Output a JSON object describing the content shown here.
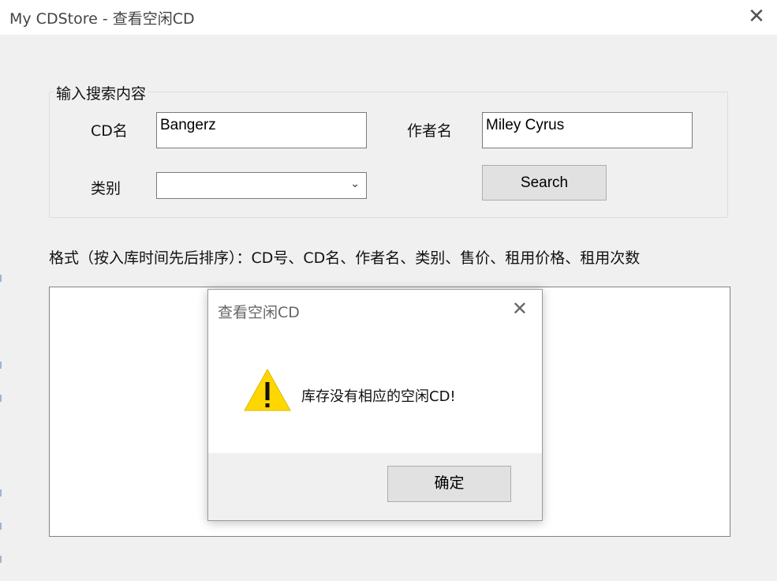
{
  "window": {
    "title": "My CDStore - 查看空闲CD"
  },
  "search_group": {
    "legend": "输入搜索内容",
    "cd_name_label": "CD名",
    "cd_name_value": "Bangerz",
    "author_label": "作者名",
    "author_value": "Miley Cyrus",
    "category_label": "类别",
    "category_value": "",
    "search_button": "Search"
  },
  "format_line": "格式（按入库时间先后排序）：CD号、CD名、作者名、类别、售价、租用价格、租用次数",
  "results_list": [],
  "dialog": {
    "title": "查看空闲CD",
    "icon": "warning-icon",
    "message": "库存没有相应的空闲CD!",
    "ok_button": "确定"
  },
  "colors": {
    "window_bg": "#f0f0f0",
    "titlebar_bg": "#ffffff",
    "warning_yellow": "#ffd700",
    "button_bg": "#e1e1e1"
  }
}
